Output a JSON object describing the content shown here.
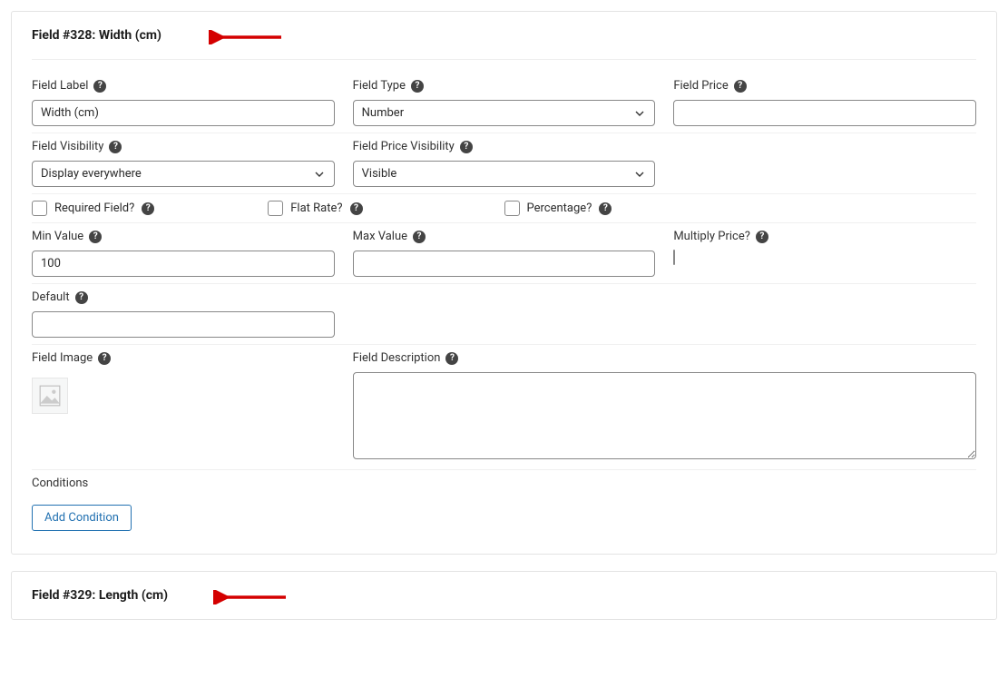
{
  "panel1": {
    "title": "Field #328: Width (cm)",
    "fieldLabel": {
      "label": "Field Label",
      "value": "Width (cm)"
    },
    "fieldType": {
      "label": "Field Type",
      "value": "Number"
    },
    "fieldPrice": {
      "label": "Field Price",
      "value": ""
    },
    "fieldVisibility": {
      "label": "Field Visibility",
      "value": "Display everywhere"
    },
    "fieldPriceVisibility": {
      "label": "Field Price Visibility",
      "value": "Visible"
    },
    "required": {
      "label": "Required Field?"
    },
    "flatRate": {
      "label": "Flat Rate?"
    },
    "percentage": {
      "label": "Percentage?"
    },
    "minValue": {
      "label": "Min Value",
      "value": "100"
    },
    "maxValue": {
      "label": "Max Value",
      "value": ""
    },
    "multiplyPrice": {
      "label": "Multiply Price?"
    },
    "default": {
      "label": "Default",
      "value": ""
    },
    "fieldImage": {
      "label": "Field Image"
    },
    "fieldDescription": {
      "label": "Field Description",
      "value": ""
    },
    "conditions": {
      "label": "Conditions",
      "button": "Add Condition"
    }
  },
  "panel2": {
    "title": "Field #329: Length (cm)"
  }
}
